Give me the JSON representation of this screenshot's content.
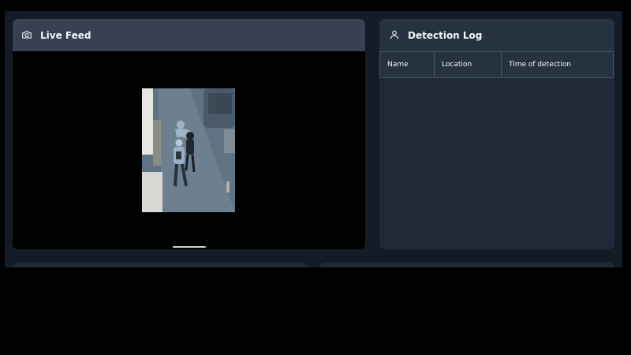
{
  "live_feed": {
    "title": "Live Feed",
    "icon": "camera-icon"
  },
  "detection_log": {
    "title": "Detection Log",
    "icon": "user-icon",
    "columns": [
      "Name",
      "Location",
      "Time of detection"
    ]
  },
  "colors": {
    "page_bg": "#131b26",
    "panel_bg": "#1f2937",
    "header_bg": "#374151",
    "border": "#4b5563"
  }
}
